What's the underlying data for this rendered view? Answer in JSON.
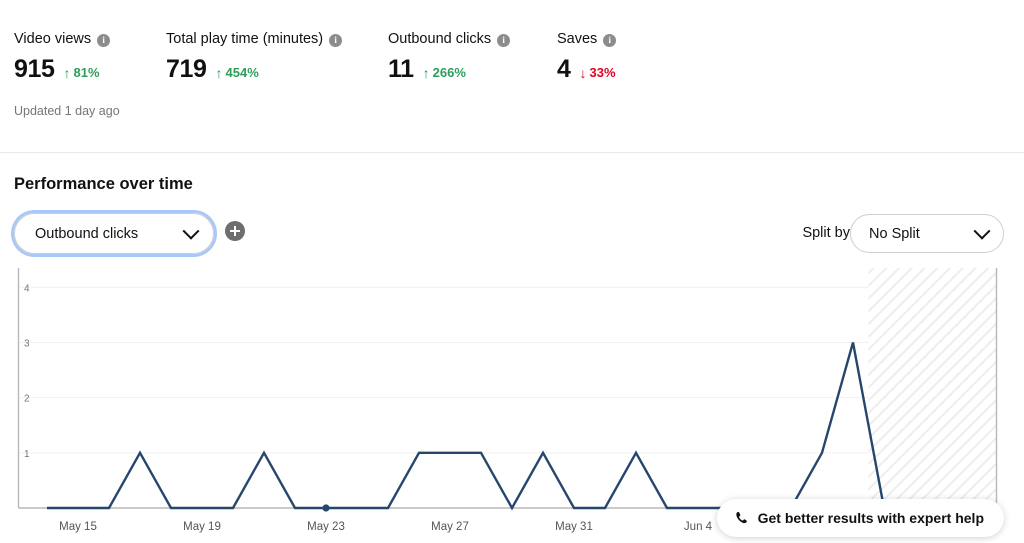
{
  "metrics": [
    {
      "label": "Video views",
      "value": "915",
      "delta": "81%",
      "direction": "up",
      "info_icon": "info-icon"
    },
    {
      "label": "Total play time (minutes)",
      "value": "719",
      "delta": "454%",
      "direction": "up",
      "info_icon": "info-icon"
    },
    {
      "label": "Outbound clicks",
      "value": "11",
      "delta": "266%",
      "direction": "up",
      "info_icon": "info-icon"
    },
    {
      "label": "Saves",
      "value": "4",
      "delta": "33%",
      "direction": "down",
      "info_icon": "info-icon"
    }
  ],
  "updated_text": "Updated 1 day ago",
  "performance": {
    "title": "Performance over time",
    "metric_select_value": "Outbound clicks",
    "add_metric_icon": "plus-icon",
    "split_by_label": "Split by",
    "split_by_value": "No Split"
  },
  "expert_help": {
    "label": "Get better results with expert help",
    "icon": "phone-icon"
  },
  "colors": {
    "line": "#26466d",
    "up": "#2e9e5b",
    "down": "#e60023",
    "focus_ring": "#a8c8f8",
    "grid": "#f1f1f1"
  },
  "chart_data": {
    "type": "line",
    "title": "Performance over time",
    "xlabel": "",
    "ylabel": "Outbound clicks",
    "ylim": [
      0,
      4.35
    ],
    "yticks": [
      1,
      2,
      3,
      4
    ],
    "grid": true,
    "legend": null,
    "x": [
      "May 13",
      "May 14",
      "May 15",
      "May 16",
      "May 17",
      "May 18",
      "May 19",
      "May 20",
      "May 21",
      "May 22",
      "May 23",
      "May 24",
      "May 25",
      "May 26",
      "May 27",
      "May 28",
      "May 29",
      "May 30",
      "May 31",
      "Jun 1",
      "Jun 2",
      "Jun 3",
      "Jun 4",
      "Jun 5",
      "Jun 6",
      "Jun 7",
      "Jun 8",
      "Jun 9",
      "Jun 10",
      "Jun 11"
    ],
    "xtick_labels": [
      "May 15",
      "May 19",
      "May 23",
      "May 27",
      "May 31",
      "Jun 4"
    ],
    "xtick_indices": [
      2,
      6,
      10,
      14,
      18,
      22
    ],
    "values": [
      0,
      0,
      0,
      0,
      1,
      0,
      0,
      0,
      1,
      0,
      0,
      0,
      0,
      1,
      1,
      1,
      0,
      1,
      0,
      0,
      1,
      0,
      0,
      0,
      0,
      0,
      1,
      3,
      0,
      0
    ],
    "marker_points": [
      {
        "x": "May 23",
        "y": 0
      }
    ],
    "forecast_shaded_from": "Jun 9"
  }
}
